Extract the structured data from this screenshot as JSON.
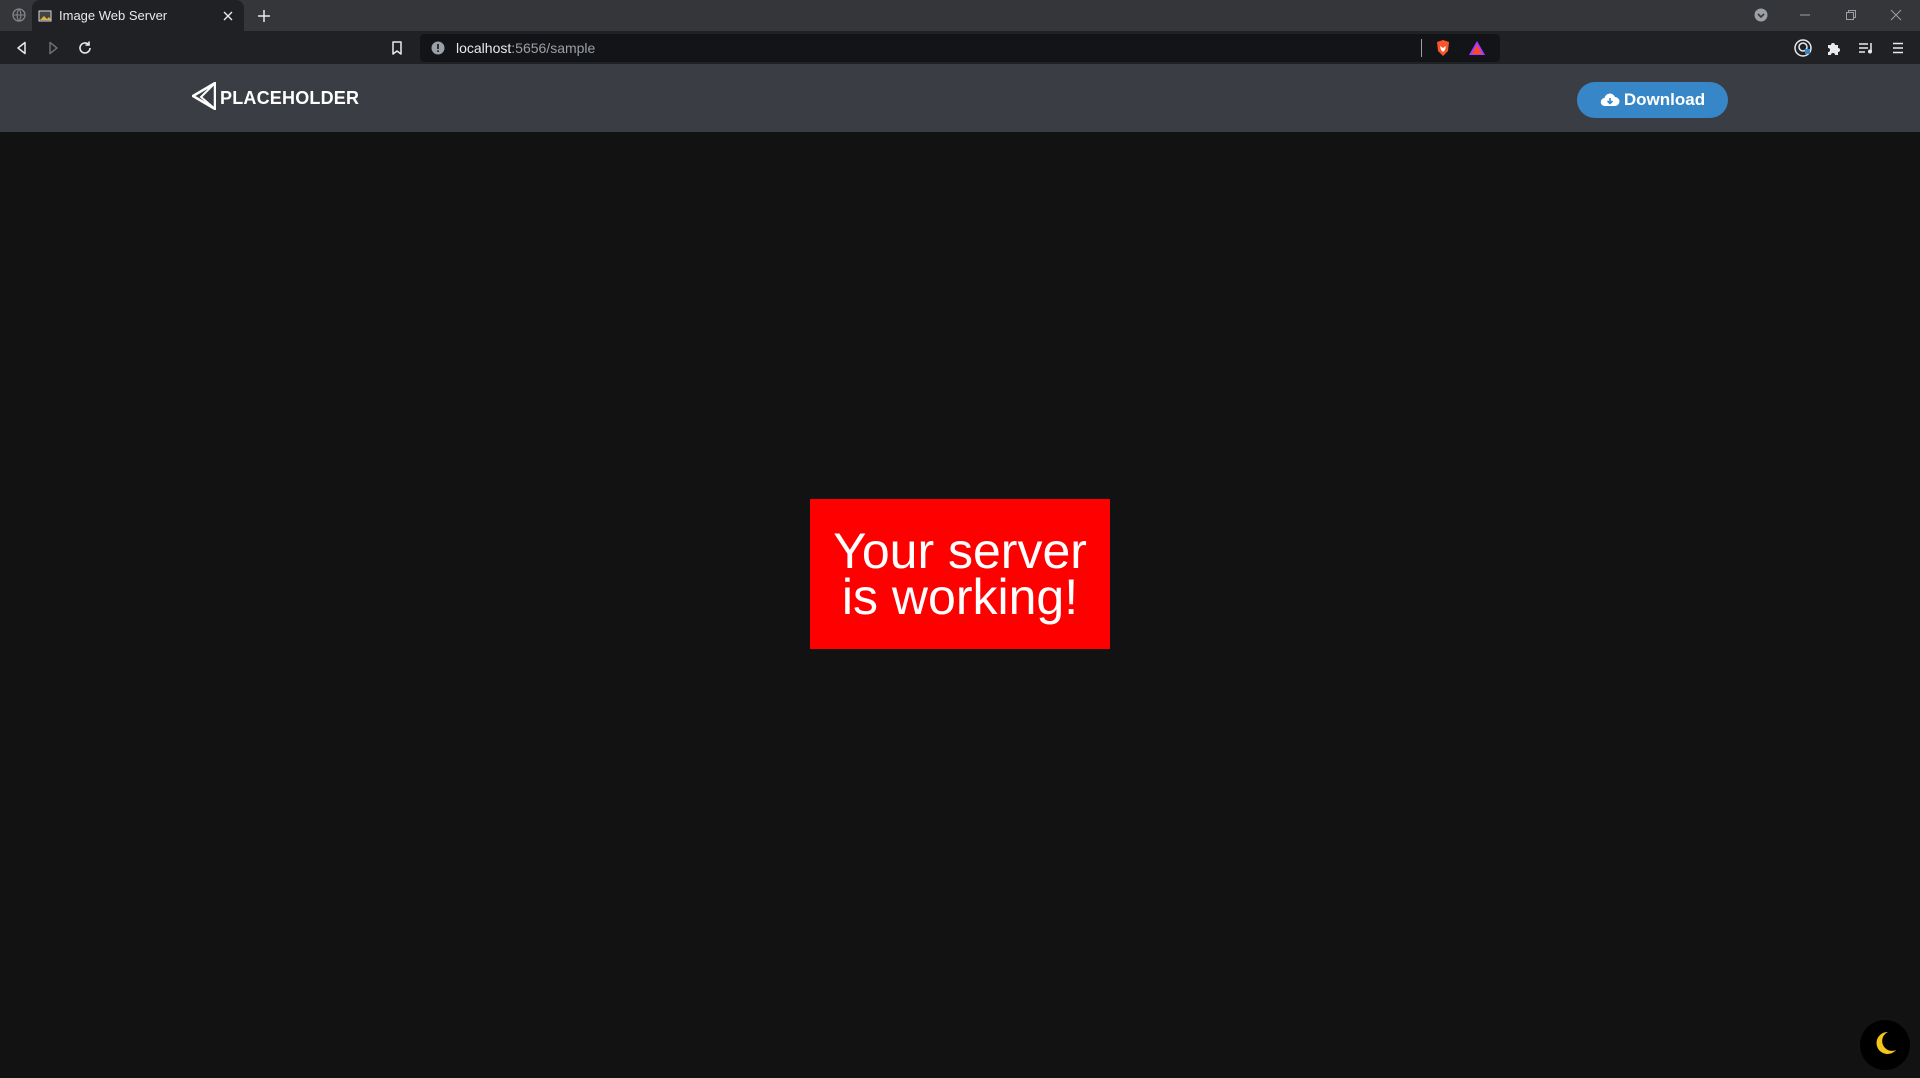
{
  "browser": {
    "tab": {
      "title": "Image Web Server"
    },
    "address_bar": {
      "host": "localhost",
      "path": ":5656/sample"
    },
    "icons": {
      "sys_menu": "globe-icon",
      "favicon": "image-favicon-icon",
      "tab_close": "close-icon",
      "new_tab": "plus-icon",
      "tab_search": "chevron-down-icon",
      "minimize": "minimize-icon",
      "restore": "restore-icon",
      "close_window": "close-icon",
      "back": "back-arrow-icon",
      "forward": "forward-arrow-icon",
      "reload": "reload-icon",
      "bookmark": "bookmark-icon",
      "site_info": "info-icon",
      "brave_shields": "brave-shield-icon",
      "brave_rewards": "brave-rewards-icon",
      "profile": "profile-icon",
      "extensions": "puzzle-icon",
      "media": "playlist-icon",
      "menu": "hamburger-icon"
    }
  },
  "header": {
    "logo_text": "PLACEHOLDER",
    "download_label": "Download"
  },
  "main": {
    "image_text": "Your server is working!",
    "image_bg": "#ff0000"
  },
  "colors": {
    "accent": "#3787c8",
    "page_bg": "#121212",
    "header_bg": "#3a3d44",
    "moon": "#f5c518"
  }
}
